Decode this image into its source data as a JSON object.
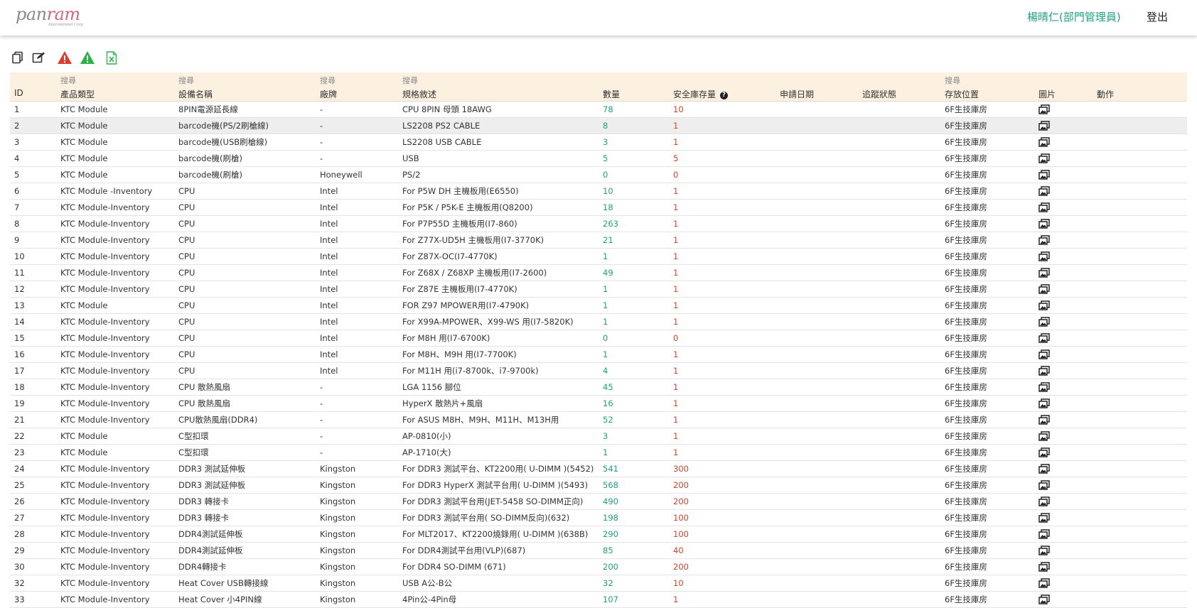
{
  "header": {
    "logo_text_main": "pan",
    "logo_text_accent": "ram",
    "logo_subtext": "International Corp",
    "user_label": "楊晴仁(部門管理員)",
    "logout_label": "登出"
  },
  "toolbar": {
    "icons": [
      "copy-icon",
      "edit-icon",
      "warning-red-icon",
      "warning-green-icon",
      "excel-icon"
    ]
  },
  "colors": {
    "accent_green": "#1fa57e",
    "qty_green": "#1ea37b",
    "safe_red": "#d9412b",
    "header_bg": "#fcf0e1",
    "warning_red": "#e03a2e",
    "warning_green": "#2db24a",
    "logo_accent": "#d9667a"
  },
  "table": {
    "search_label": "搜尋",
    "columns": {
      "id": "ID",
      "type": "產品類型",
      "device": "設備名稱",
      "brand": "廠牌",
      "spec": "規格敘述",
      "qty": "數量",
      "safe": "安全庫存量",
      "date": "申請日期",
      "track": "追蹤狀態",
      "loc": "存放位置",
      "img": "圖片",
      "action": "動作"
    },
    "rows": [
      {
        "id": "1",
        "type": "KTC Module",
        "device": "8PIN電源延長線",
        "brand": "-",
        "spec": "CPU 8PIN 母頭 18AWG",
        "qty": "78",
        "safe": "10",
        "date": "",
        "track": "",
        "loc": "6F生技庫房"
      },
      {
        "id": "2",
        "type": "KTC Module",
        "device": "barcode機(PS/2刷槍線)",
        "brand": "-",
        "spec": "LS2208 PS2 CABLE",
        "qty": "8",
        "safe": "1",
        "date": "",
        "track": "",
        "loc": "6F生技庫房"
      },
      {
        "id": "3",
        "type": "KTC Module",
        "device": "barcode機(USB刷槍線)",
        "brand": "-",
        "spec": "LS2208 USB CABLE",
        "qty": "3",
        "safe": "1",
        "date": "",
        "track": "",
        "loc": "6F生技庫房"
      },
      {
        "id": "4",
        "type": "KTC Module",
        "device": "barcode機(刷槍)",
        "brand": "-",
        "spec": "USB",
        "qty": "5",
        "safe": "5",
        "date": "",
        "track": "",
        "loc": "6F生技庫房"
      },
      {
        "id": "5",
        "type": "KTC Module",
        "device": "barcode機(刷槍)",
        "brand": "Honeywell",
        "spec": "PS/2",
        "qty": "0",
        "safe": "0",
        "date": "",
        "track": "",
        "loc": "6F生技庫房"
      },
      {
        "id": "6",
        "type": "KTC Module -Inventory",
        "device": "CPU",
        "brand": "Intel",
        "spec": "For P5W DH 主機板用(E6550)",
        "qty": "10",
        "safe": "1",
        "date": "",
        "track": "",
        "loc": "6F生技庫房"
      },
      {
        "id": "7",
        "type": "KTC Module-Inventory",
        "device": "CPU",
        "brand": "Intel",
        "spec": "For P5K / P5K-E 主機板用(Q8200)",
        "qty": "18",
        "safe": "1",
        "date": "",
        "track": "",
        "loc": "6F生技庫房"
      },
      {
        "id": "8",
        "type": "KTC Module-Inventory",
        "device": "CPU",
        "brand": "Intel",
        "spec": "For P7P55D 主機板用(I7-860)",
        "qty": "263",
        "safe": "1",
        "date": "",
        "track": "",
        "loc": "6F生技庫房"
      },
      {
        "id": "9",
        "type": "KTC Module-Inventory",
        "device": "CPU",
        "brand": "Intel",
        "spec": "For Z77X-UD5H 主機板用(I7-3770K)",
        "qty": "21",
        "safe": "1",
        "date": "",
        "track": "",
        "loc": "6F生技庫房"
      },
      {
        "id": "10",
        "type": "KTC Module-Inventory",
        "device": "CPU",
        "brand": "Intel",
        "spec": "For Z87X-OC(I7-4770K)",
        "qty": "1",
        "safe": "1",
        "date": "",
        "track": "",
        "loc": "6F生技庫房"
      },
      {
        "id": "11",
        "type": "KTC Module-Inventory",
        "device": "CPU",
        "brand": "Intel",
        "spec": "For Z68X / Z68XP 主機板用(I7-2600)",
        "qty": "49",
        "safe": "1",
        "date": "",
        "track": "",
        "loc": "6F生技庫房"
      },
      {
        "id": "12",
        "type": "KTC Module-Inventory",
        "device": "CPU",
        "brand": "Intel",
        "spec": "For Z87E 主機板用(I7-4770K)",
        "qty": "1",
        "safe": "1",
        "date": "",
        "track": "",
        "loc": "6F生技庫房"
      },
      {
        "id": "13",
        "type": "KTC Module",
        "device": "CPU",
        "brand": "Intel",
        "spec": "FOR Z97 MPOWER用(I7-4790K)",
        "qty": "1",
        "safe": "1",
        "date": "",
        "track": "",
        "loc": "6F生技庫房"
      },
      {
        "id": "14",
        "type": "KTC Module-Inventory",
        "device": "CPU",
        "brand": "Intel",
        "spec": "For X99A-MPOWER、X99-WS 用(I7-5820K)",
        "qty": "1",
        "safe": "1",
        "date": "",
        "track": "",
        "loc": "6F生技庫房"
      },
      {
        "id": "15",
        "type": "KTC Module-Inventory",
        "device": "CPU",
        "brand": "Intel",
        "spec": "For M8H 用(I7-6700K)",
        "qty": "0",
        "safe": "0",
        "date": "",
        "track": "",
        "loc": "6F生技庫房"
      },
      {
        "id": "16",
        "type": "KTC Module-Inventory",
        "device": "CPU",
        "brand": "Intel",
        "spec": "For M8H、M9H 用(I7-7700K)",
        "qty": "1",
        "safe": "1",
        "date": "",
        "track": "",
        "loc": "6F生技庫房"
      },
      {
        "id": "17",
        "type": "KTC Module-Inventory",
        "device": "CPU",
        "brand": "Intel",
        "spec": "For M11H 用(i7-8700k、i7-9700k)",
        "qty": "4",
        "safe": "1",
        "date": "",
        "track": "",
        "loc": "6F生技庫房"
      },
      {
        "id": "18",
        "type": "KTC Module-Inventory",
        "device": "CPU 散熱風扇",
        "brand": "-",
        "spec": "LGA 1156 腳位",
        "qty": "45",
        "safe": "1",
        "date": "",
        "track": "",
        "loc": "6F生技庫房"
      },
      {
        "id": "19",
        "type": "KTC Module-Inventory",
        "device": "CPU 散熱風扇",
        "brand": "-",
        "spec": "HyperX 散熱片+風扇",
        "qty": "16",
        "safe": "1",
        "date": "",
        "track": "",
        "loc": "6F生技庫房"
      },
      {
        "id": "21",
        "type": "KTC Module-Inventory",
        "device": "CPU散熱風扇(DDR4)",
        "brand": "-",
        "spec": "For ASUS M8H、M9H、M11H、M13H用",
        "qty": "52",
        "safe": "1",
        "date": "",
        "track": "",
        "loc": "6F生技庫房"
      },
      {
        "id": "22",
        "type": "KTC Module",
        "device": "C型扣環",
        "brand": "-",
        "spec": "AP-0810(小)",
        "qty": "3",
        "safe": "1",
        "date": "",
        "track": "",
        "loc": "6F生技庫房"
      },
      {
        "id": "23",
        "type": "KTC Module",
        "device": "C型扣環",
        "brand": "-",
        "spec": "AP-1710(大)",
        "qty": "1",
        "safe": "1",
        "date": "",
        "track": "",
        "loc": "6F生技庫房"
      },
      {
        "id": "24",
        "type": "KTC Module-Inventory",
        "device": "DDR3 測試延伸板",
        "brand": "Kingston",
        "spec": "For DDR3 測試平台、KT2200用( U-DIMM )(5452)",
        "qty": "541",
        "safe": "300",
        "date": "",
        "track": "",
        "loc": "6F生技庫房"
      },
      {
        "id": "25",
        "type": "KTC Module-Inventory",
        "device": "DDR3 測試延伸板",
        "brand": "Kingston",
        "spec": "For DDR3 HyperX 測試平台用( U-DIMM )(5493)",
        "qty": "568",
        "safe": "200",
        "date": "",
        "track": "",
        "loc": "6F生技庫房"
      },
      {
        "id": "26",
        "type": "KTC Module-Inventory",
        "device": "DDR3 轉接卡",
        "brand": "Kingston",
        "spec": "For DDR3 測試平台用(JET-5458 SO-DIMM正向)",
        "qty": "490",
        "safe": "200",
        "date": "",
        "track": "",
        "loc": "6F生技庫房"
      },
      {
        "id": "27",
        "type": "KTC Module-Inventory",
        "device": "DDR3 轉接卡",
        "brand": "Kingston",
        "spec": "For DDR3 測試平台用( SO-DIMM反向)(632)",
        "qty": "198",
        "safe": "100",
        "date": "",
        "track": "",
        "loc": "6F生技庫房"
      },
      {
        "id": "28",
        "type": "KTC Module-Inventory",
        "device": "DDR4測試延伸板",
        "brand": "Kingston",
        "spec": "For MLT2017、KT2200燒錄用( U-DIMM )(638B)",
        "qty": "290",
        "safe": "100",
        "date": "",
        "track": "",
        "loc": "6F生技庫房"
      },
      {
        "id": "29",
        "type": "KTC Module-Inventory",
        "device": "DDR4測試延伸板",
        "brand": "Kingston",
        "spec": "For DDR4測試平台用(VLP)(687)",
        "qty": "85",
        "safe": "40",
        "date": "",
        "track": "",
        "loc": "6F生技庫房"
      },
      {
        "id": "30",
        "type": "KTC Module-Inventory",
        "device": "DDR4轉接卡",
        "brand": "Kingston",
        "spec": "For DDR4 SO-DIMM (671)",
        "qty": "200",
        "safe": "200",
        "date": "",
        "track": "",
        "loc": "6F生技庫房"
      },
      {
        "id": "32",
        "type": "KTC Module-Inventory",
        "device": "Heat Cover USB轉接線",
        "brand": "Kingston",
        "spec": "USB A公-B公",
        "qty": "32",
        "safe": "10",
        "date": "",
        "track": "",
        "loc": "6F生技庫房"
      },
      {
        "id": "33",
        "type": "KTC Module-Inventory",
        "device": "Heat Cover 小4PIN線",
        "brand": "Kingston",
        "spec": "4Pin公-4Pin母",
        "qty": "107",
        "safe": "1",
        "date": "",
        "track": "",
        "loc": "6F生技庫房"
      }
    ]
  }
}
